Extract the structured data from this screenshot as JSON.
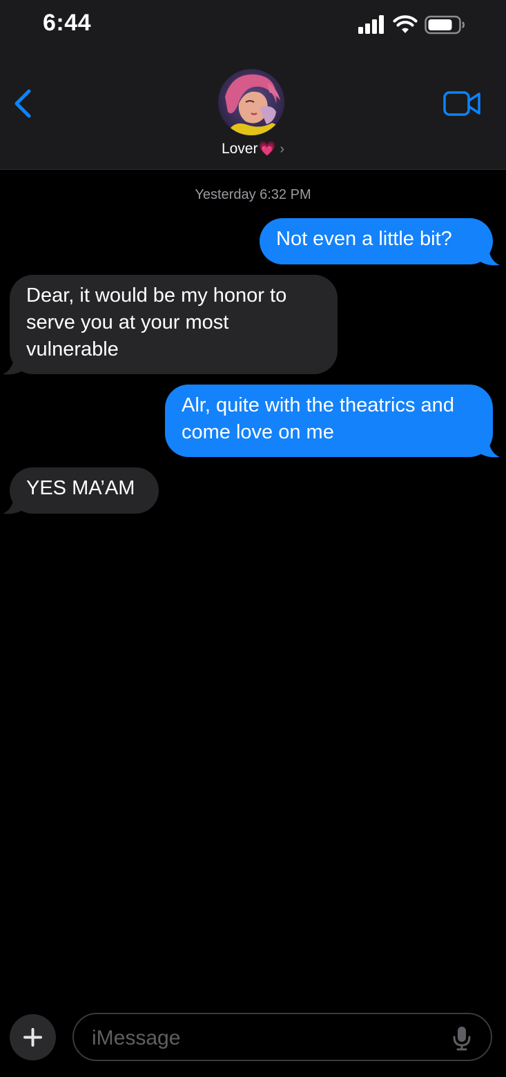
{
  "status_bar": {
    "time": "6:44",
    "signal_icon": "cellular-signal-icon",
    "wifi_icon": "wifi-icon",
    "battery_icon": "battery-icon"
  },
  "header": {
    "back_icon": "chevron-left-icon",
    "contact_name": "Lover",
    "contact_emoji": "💗",
    "chevron": "›",
    "video_icon": "video-camera-icon"
  },
  "conversation": {
    "timestamp": "Yesterday 6:32 PM",
    "messages": [
      {
        "direction": "sent",
        "text": "Not even a little bit?"
      },
      {
        "direction": "received",
        "text": "Dear, it would be my honor to serve you at your most vulnerable"
      },
      {
        "direction": "sent",
        "text": "Alr, quite with the theatrics and come love on me"
      },
      {
        "direction": "received",
        "text": "YES MA’AM"
      }
    ]
  },
  "composer": {
    "plus_icon": "plus-icon",
    "placeholder": "iMessage",
    "mic_icon": "microphone-icon"
  },
  "colors": {
    "sent_bubble": "#1482fa",
    "received_bubble": "#262629",
    "accent": "#0a84ff",
    "background": "#000000"
  }
}
